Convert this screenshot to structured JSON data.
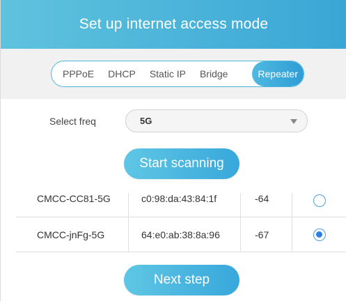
{
  "header": {
    "title": "Set up internet access mode"
  },
  "modes": [
    {
      "label": "PPPoE",
      "active": false
    },
    {
      "label": "DHCP",
      "active": false
    },
    {
      "label": "Static IP",
      "active": false
    },
    {
      "label": "Bridge",
      "active": false
    },
    {
      "label": "Repeater",
      "active": true
    }
  ],
  "freq": {
    "label": "Select freq",
    "value": "5G"
  },
  "scan_button": "Start scanning",
  "networks": [
    {
      "ssid": "CMCC-CC81-5G",
      "mac": "c0:98:da:43:84:1f",
      "signal": "-64",
      "selected": false
    },
    {
      "ssid": "CMCC-jnFg-5G",
      "mac": "64:e0:ab:38:8a:96",
      "signal": "-67",
      "selected": true
    }
  ],
  "next_button": "Next step",
  "colors": {
    "accent": "#3aa6d6",
    "radio": "#2f7fde"
  }
}
